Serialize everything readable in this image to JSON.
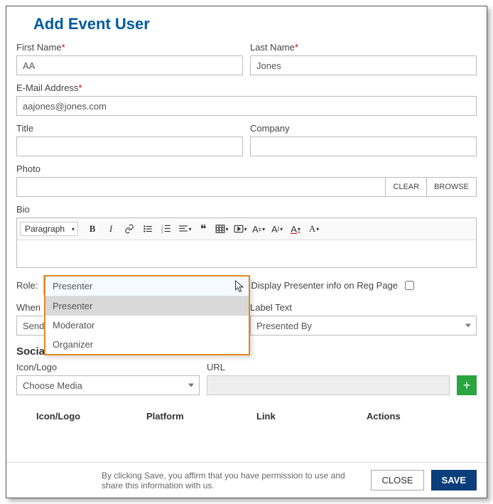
{
  "header": {
    "title": "Add Event User"
  },
  "labels": {
    "first_name": "First Name",
    "last_name": "Last Name",
    "email": "E-Mail Address",
    "title": "Title",
    "company": "Company",
    "photo": "Photo",
    "bio": "Bio",
    "role": "Role:",
    "display_presenter": "Display Presenter info on Reg Page",
    "when": "When",
    "label_text": "Label Text",
    "social_section": "Social Media and Websites",
    "icon_logo": "Icon/Logo",
    "url": "URL"
  },
  "values": {
    "first_name": "AA",
    "last_name": "Jones",
    "email": "aajones@jones.com",
    "title": "",
    "company": "",
    "photo": "",
    "role_selected": "Presenter",
    "when_selected": "Send",
    "label_text_selected": "Presented By",
    "choose_media": "Choose Media",
    "display_presenter_checked": false
  },
  "role_options": [
    "Presenter",
    "Moderator",
    "Organizer"
  ],
  "photo_buttons": {
    "clear": "CLEAR",
    "browse": "BROWSE"
  },
  "rte": {
    "format": "Paragraph"
  },
  "table_headers": {
    "c1": "Icon/Logo",
    "c2": "Platform",
    "c3": "Link",
    "c4": "Actions"
  },
  "footer": {
    "affirm": "By clicking Save, you affirm that you have permission to use and share this information with us.",
    "close": "CLOSE",
    "save": "SAVE"
  },
  "required_marker": "*",
  "icons": {
    "add": "+"
  }
}
